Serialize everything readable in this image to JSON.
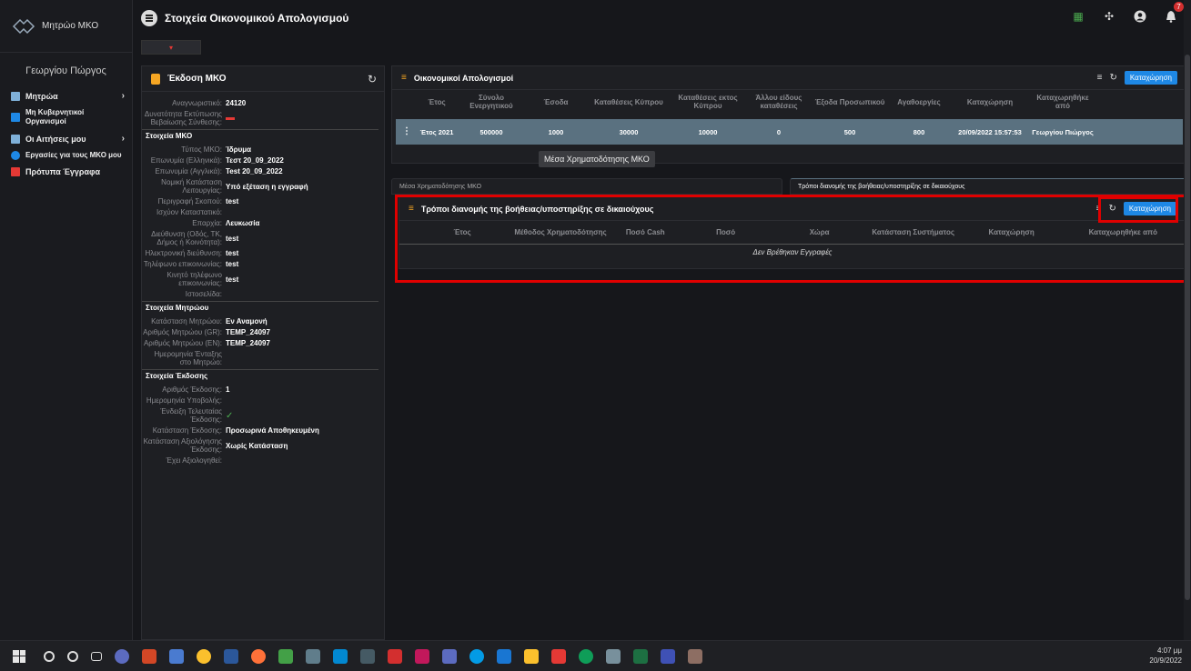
{
  "app": {
    "brand": "Μητρώο ΜΚΟ",
    "page_title": "Στοιχεία Οικονομικού Απολογισμού",
    "user_name": "Γεωργίου Πώργος",
    "notifications": "7"
  },
  "sidebar": {
    "items": [
      {
        "label": "Μητρώα",
        "icon": "registry-icon",
        "chevron": true,
        "color": "#7fb0d8"
      },
      {
        "label": "Μη Κυβερνητικοί Οργανισμοί",
        "icon": "folder-icon",
        "chevron": false,
        "color": "#1e88e5",
        "sub": true
      },
      {
        "label": "Οι Αιτήσεις μου",
        "icon": "applications-icon",
        "chevron": true,
        "color": "#7fb0d8"
      },
      {
        "label": "Εργασίες για τους ΜΚΟ μου",
        "icon": "tasks-icon",
        "chevron": false,
        "color": "#1e88e5",
        "sub": true
      },
      {
        "label": "Πρότυπα Έγγραφα",
        "icon": "folder-icon",
        "chevron": false,
        "color": "#e53935"
      }
    ]
  },
  "left_panel": {
    "title": "Έκδοση ΜΚΟ",
    "fields": [
      {
        "label": "Αναγνωριστικό:",
        "value": "24120"
      },
      {
        "label": "Δυνατότητα Εκτύπωσης Βεβαίωσης Σύνθεσης:",
        "value": "",
        "dash": true
      },
      {
        "section": "Στοιχεία ΜΚΟ"
      },
      {
        "label": "Τύπος ΜΚΟ:",
        "value": "Ίδρυμα"
      },
      {
        "label": "Επωνυμία (Ελληνικά):",
        "value": "Τεστ 20_09_2022"
      },
      {
        "label": "Επωνυμία (Αγγλικά):",
        "value": "Test 20_09_2022"
      },
      {
        "label": "Νομική Κατάσταση Λειτουργίας:",
        "value": "Υπό εξέταση η εγγραφή"
      },
      {
        "label": "Περιγραφή Σκοπού:",
        "value": "test"
      },
      {
        "label": "Ισχύον Καταστατικό:",
        "value": ""
      },
      {
        "label": "Επαρχία:",
        "value": "Λευκωσία"
      },
      {
        "label": "Διεύθυνση (Οδός, ΤΚ, Δήμος ή Κοινότητα):",
        "value": "test"
      },
      {
        "label": "Ηλεκτρονική διεύθυνση:",
        "value": "test"
      },
      {
        "label": "Τηλέφωνο επικοινωνίας:",
        "value": "test"
      },
      {
        "label": "Κινητό τηλέφωνο επικοινωνίας:",
        "value": "test"
      },
      {
        "label": "Ιστοσελίδα:",
        "value": ""
      },
      {
        "section": "Στοιχεία Μητρώου"
      },
      {
        "label": "Κατάσταση Μητρώου:",
        "value": "Εν Αναμονή"
      },
      {
        "label": "Αριθμός Μητρώου (GR):",
        "value": "TEMP_24097"
      },
      {
        "label": "Αριθμός Μητρώου (EN):",
        "value": "TEMP_24097"
      },
      {
        "label": "Ημερομηνία Ένταξης στο Μητρώο:",
        "value": ""
      },
      {
        "section": "Στοιχεία Έκδοσης"
      },
      {
        "label": "Αριθμός Έκδοσης:",
        "value": "1"
      },
      {
        "label": "Ημερομηνία Υποβολής:",
        "value": ""
      },
      {
        "label": "Ένδειξη Τελευταίας Έκδοσης:",
        "value": "",
        "check": true
      },
      {
        "label": "Κατάσταση Έκδοσης:",
        "value": "Προσωρινά Αποθηκευμένη"
      },
      {
        "label": "Κατάσταση Αξιολόγησης Έκδοσης:",
        "value": "Χωρίς Κατάσταση"
      },
      {
        "label": "Έχει Αξιολογηθεί:",
        "value": ""
      }
    ]
  },
  "financial": {
    "title": "Οικονομικοί Απολογισμοί",
    "add_label": "Καταχώρηση",
    "columns": [
      "Έτος",
      "Σύνολο Ενεργητικού",
      "Έσοδα",
      "Καταθέσεις Κύπρου",
      "Καταθέσεις εκτος Κύπρου",
      "Άλλου είδους καταθέσεις",
      "Έξοδα Προσωπικού",
      "Αγαθοεργίες",
      "Καταχώρηση",
      "Καταχωρηθήκε από"
    ],
    "rows": [
      [
        "Έτος 2021",
        "500000",
        "1000",
        "30000",
        "10000",
        "0",
        "500",
        "800",
        "20/09/2022 15:57:53",
        "Γεωργίου Πιώργος"
      ]
    ],
    "tooltip": "Μέσα Χρηματοδότησης ΜΚΟ"
  },
  "tabs": [
    {
      "label": "Μέσα Χρηματοδότησης ΜΚΟ",
      "active": false
    },
    {
      "label": "Τρόποι διανομής της βοήθειας/υποστηρίξης σε δικαιούχους",
      "active": true
    }
  ],
  "distribution": {
    "title": "Τρόποι διανομής της βοήθειας/υποστηρίξης σε δικαιούχους",
    "add_label": "Καταχώρηση",
    "columns": [
      "Έτος",
      "Μέθοδος Χρηματοδότησης",
      "Ποσό Cash",
      "Ποσό",
      "Χώρα",
      "Κατάσταση Συστήματος",
      "Καταχώρηση",
      "Καταχωρηθήκε από"
    ],
    "empty": "Δεν Βρέθηκαν Εγγραφές"
  },
  "taskbar": {
    "time": "4:07 μμ",
    "date": "20/9/2022"
  }
}
